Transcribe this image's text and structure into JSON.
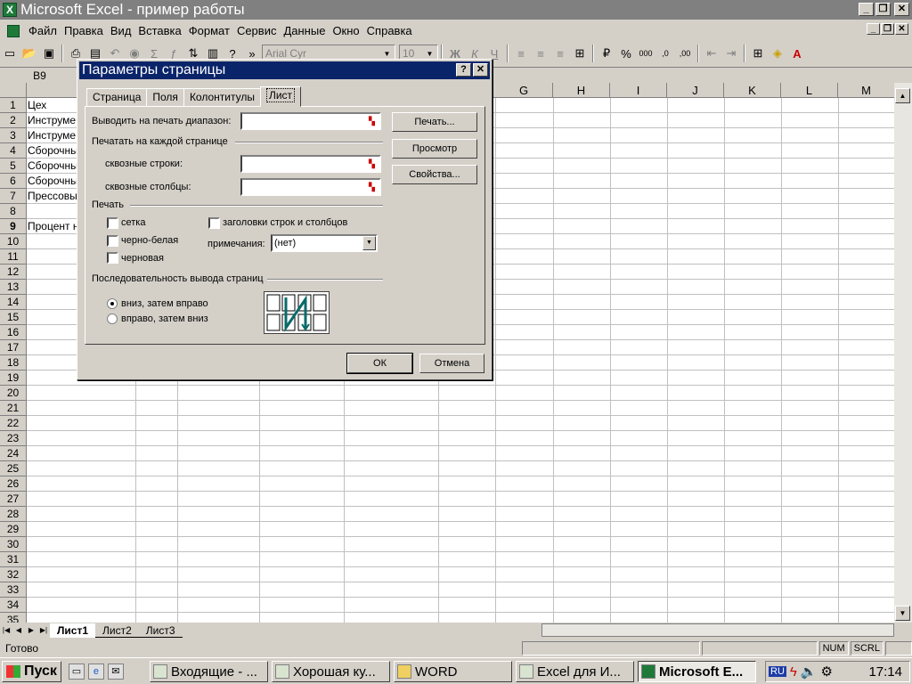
{
  "window": {
    "title": "Microsoft Excel - пример работы",
    "app_icon": "excel-icon"
  },
  "menubar": {
    "items": [
      {
        "label": "Файл"
      },
      {
        "label": "Правка"
      },
      {
        "label": "Вид"
      },
      {
        "label": "Вставка"
      },
      {
        "label": "Формат"
      },
      {
        "label": "Сервис"
      },
      {
        "label": "Данные"
      },
      {
        "label": "Окно"
      },
      {
        "label": "Справка"
      }
    ]
  },
  "toolbar": {
    "font_name": "Arial Cyr",
    "font_size": "10",
    "overflow_glyph": "»"
  },
  "formula_bar": {
    "name_box": "B9"
  },
  "sheet": {
    "columns": [
      "G",
      "H",
      "I",
      "J",
      "K",
      "L",
      "M"
    ],
    "rows": [
      "1",
      "2",
      "3",
      "4",
      "5",
      "6",
      "7",
      "8",
      "9",
      "10",
      "11",
      "12",
      "13",
      "14",
      "15",
      "16",
      "17",
      "18",
      "19",
      "20",
      "21",
      "22",
      "23",
      "24",
      "25",
      "26",
      "27",
      "28",
      "29",
      "30",
      "31",
      "32",
      "33",
      "34",
      "35"
    ],
    "cells": [
      {
        "row": 1,
        "text": "Цех"
      },
      {
        "row": 2,
        "text": "Инструме"
      },
      {
        "row": 3,
        "text": "Инструме"
      },
      {
        "row": 4,
        "text": "Сборочны"
      },
      {
        "row": 5,
        "text": "Сборочны"
      },
      {
        "row": 6,
        "text": "Сборочны"
      },
      {
        "row": 7,
        "text": "Прессовы"
      },
      {
        "row": 9,
        "text": "Процент н"
      }
    ],
    "tabs": [
      "Лист1",
      "Лист2",
      "Лист3"
    ]
  },
  "status": {
    "ready": "Готово",
    "num": "NUM",
    "scrl": "SCRL"
  },
  "dialog": {
    "title": "Параметры страницы",
    "help_glyph": "?",
    "close_glyph": "✕",
    "tabs": [
      "Страница",
      "Поля",
      "Колонтитулы",
      "Лист"
    ],
    "active_tab": "Лист",
    "print_area_label": "Выводить на печать диапазон:",
    "print_titles_group": "Печатать на каждой странице",
    "rows_to_repeat_label": "сквозные строки:",
    "cols_to_repeat_label": "сквозные столбцы:",
    "print_group": "Печать",
    "gridlines_label": "сетка",
    "bw_label": "черно-белая",
    "draft_label": "черновая",
    "headings_label": "заголовки строк и столбцов",
    "comments_label": "примечания:",
    "comments_value": "(нет)",
    "order_group": "Последовательность вывода страниц",
    "down_then_over": "вниз, затем вправо",
    "over_then_down": "вправо, затем вниз",
    "print_button": "Печать...",
    "preview_button": "Просмотр",
    "properties_button": "Свойства...",
    "ok_button": "ОК",
    "cancel_button": "Отмена"
  },
  "taskbar": {
    "start": "Пуск",
    "tasks": [
      {
        "label": "Входящие - ..."
      },
      {
        "label": "Хорошая ку..."
      },
      {
        "label": "WORD"
      },
      {
        "label": "Excel для И..."
      },
      {
        "label": "Microsoft E..."
      }
    ],
    "lang": "RU",
    "clock": "17:14"
  }
}
